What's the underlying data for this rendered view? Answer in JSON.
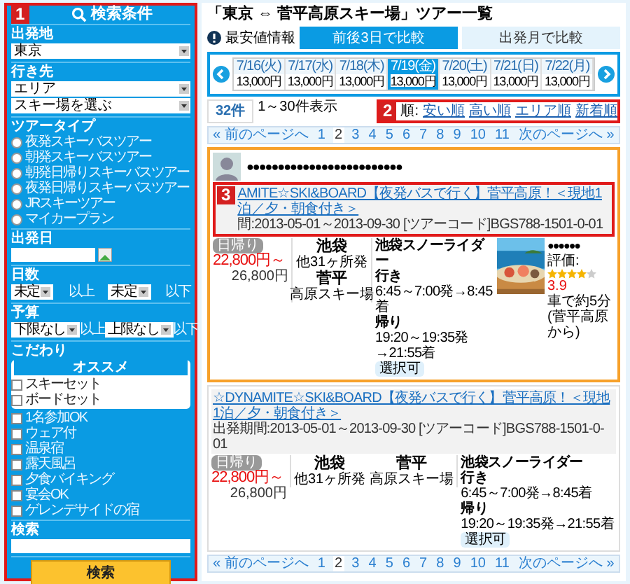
{
  "sidebar": {
    "badge": "1",
    "title": "検索条件",
    "sections": [
      {
        "kind": "select",
        "label": "出発地",
        "selects": [
          "東京"
        ]
      },
      {
        "kind": "select",
        "label": "行き先",
        "selects": [
          "エリア",
          "スキー場を選ぶ"
        ]
      },
      {
        "kind": "radios",
        "label": "ツアータイプ",
        "options": [
          {
            "label": "夜発スキーバスツアー",
            "selected": false
          },
          {
            "label": "朝発スキーバスツアー",
            "selected": false
          },
          {
            "label": "朝発日帰りスキーバスツアー",
            "selected": false
          },
          {
            "label": "夜発日帰りスキーバスツアー",
            "selected": false
          },
          {
            "label": "JRスキーツアー",
            "selected": false
          },
          {
            "label": "マイカープラン",
            "selected": false
          }
        ]
      },
      {
        "kind": "date",
        "label": "出発日"
      },
      {
        "kind": "range",
        "label": "日数",
        "fields": [
          {
            "value": "未定",
            "suffix": "以上"
          },
          {
            "value": "未定",
            "suffix": "以下"
          }
        ]
      },
      {
        "kind": "range",
        "label": "予算",
        "fields": [
          {
            "value": "下限なし",
            "suffix": "以上"
          },
          {
            "value": "上限なし",
            "suffix": "以下"
          }
        ]
      },
      {
        "kind": "checks",
        "label": "こだわり",
        "featured": {
          "title": "オススメ",
          "options": [
            {
              "label": "スキーセット",
              "checked": false
            },
            {
              "label": "ボードセット",
              "checked": false
            }
          ]
        },
        "options": [
          {
            "label": "1名参加OK",
            "checked": false
          },
          {
            "label": "ウェア付",
            "checked": false
          },
          {
            "label": "温泉宿",
            "checked": false
          },
          {
            "label": "露天風呂",
            "checked": false
          },
          {
            "label": "夕食バイキング",
            "checked": false
          },
          {
            "label": "宴会OK",
            "checked": false
          },
          {
            "label": "ゲレンデサイドの宿",
            "checked": false
          }
        ]
      },
      {
        "kind": "text",
        "label": "検索"
      }
    ],
    "button": "検索"
  },
  "main": {
    "title": "「東京 ⇔ 菅平高原スキー場」ツアー一覧",
    "info": "最安値情報",
    "tabs": [
      {
        "label": "前後3日で比較",
        "selected": true
      },
      {
        "label": "出発月で比較",
        "selected": false
      }
    ],
    "dates": [
      {
        "date": "7/16(火)",
        "price": "13,000円",
        "selected": false
      },
      {
        "date": "7/17(水)",
        "price": "13,000円",
        "selected": false
      },
      {
        "date": "7/18(木)",
        "price": "13,000円",
        "selected": false
      },
      {
        "date": "7/19(金)",
        "price": "13,000円",
        "selected": true
      },
      {
        "date": "7/20(土)",
        "price": "13,000円",
        "selected": false
      },
      {
        "date": "7/21(日)",
        "price": "13,000円",
        "selected": false
      },
      {
        "date": "7/22(月)",
        "price": "13,000円",
        "selected": false
      }
    ],
    "count": "32件",
    "shown": "1～30件表示",
    "sort": {
      "badge": "2",
      "label": "順:",
      "options": [
        "安い順",
        "高い順",
        "エリア順",
        "新着順"
      ]
    },
    "pagination_top": [
      {
        "label": "« 前のページへ",
        "selected": false
      },
      {
        "label": "1",
        "selected": false
      },
      {
        "label": "2",
        "selected": true
      },
      {
        "label": "3",
        "selected": false
      },
      {
        "label": "4",
        "selected": false
      },
      {
        "label": "5",
        "selected": false
      },
      {
        "label": "6",
        "selected": false
      },
      {
        "label": "7",
        "selected": false
      },
      {
        "label": "8",
        "selected": false
      },
      {
        "label": "9",
        "selected": false
      },
      {
        "label": "10",
        "selected": false
      },
      {
        "label": "11",
        "selected": false
      },
      {
        "label": "次のページへ »",
        "selected": false
      }
    ],
    "listings": [
      {
        "kind": "featured",
        "operator": "●●●●●●●●●●●●●●●●●●●●●●●●●",
        "badge": "3",
        "title": "AMITE☆SKI&BOARD【夜発バスで行く】菅平高原！＜現地1泊／夕・朝食付き＞",
        "period": "間:2013-05-01～2013-09-30 [ツアーコード]BGS788-1501-0-01",
        "tag": "日帰り",
        "price": "22,800円～",
        "old_price": "26,800円",
        "from": "池袋",
        "from_note": "他31ヶ所発",
        "to": "菅平",
        "to_note": "高原スキー場",
        "bus": "池袋スノーライダー",
        "outbound_label": "行き",
        "outbound": "6:45～7:00発→8:45着",
        "return_label": "帰り",
        "return": "19:20～19:35発→21:55着",
        "option": "選択可",
        "hotel": "●●●●●●",
        "rating_label": "評価:",
        "stars": 4,
        "rating": "3.9",
        "access": "車で約5分(菅平高原から)"
      },
      {
        "kind": "plain",
        "title": "☆DYNAMITE☆SKI&BOARD【夜発バスで行く】菅平高原！＜現地1泊／夕・朝食付き＞",
        "period": "出発期間:2013-05-01～2013-09-30 [ツアーコード]BGS788-1501-0-01",
        "tag": "日帰り",
        "price": "22,800円～",
        "old_price": "26,800円",
        "from": "池袋",
        "from_note": "他31ヶ所発",
        "to": "菅平",
        "to_note": "高原スキー場",
        "bus": "池袋スノーライダー",
        "outbound_label": "行き",
        "outbound": "6:45～7:00発→8:45着",
        "return_label": "帰り",
        "return": "19:20～19:35発→21:55着",
        "option": "選択可"
      }
    ],
    "pagination_bottom": [
      {
        "label": "« 前のページへ",
        "selected": false
      },
      {
        "label": "1",
        "selected": false
      },
      {
        "label": "2",
        "selected": true
      },
      {
        "label": "3",
        "selected": false
      },
      {
        "label": "4",
        "selected": false
      },
      {
        "label": "5",
        "selected": false
      },
      {
        "label": "6",
        "selected": false
      },
      {
        "label": "7",
        "selected": false
      },
      {
        "label": "8",
        "selected": false
      },
      {
        "label": "9",
        "selected": false
      },
      {
        "label": "10",
        "selected": false
      },
      {
        "label": "11",
        "selected": false
      },
      {
        "label": "次のページへ »",
        "selected": false
      }
    ]
  }
}
